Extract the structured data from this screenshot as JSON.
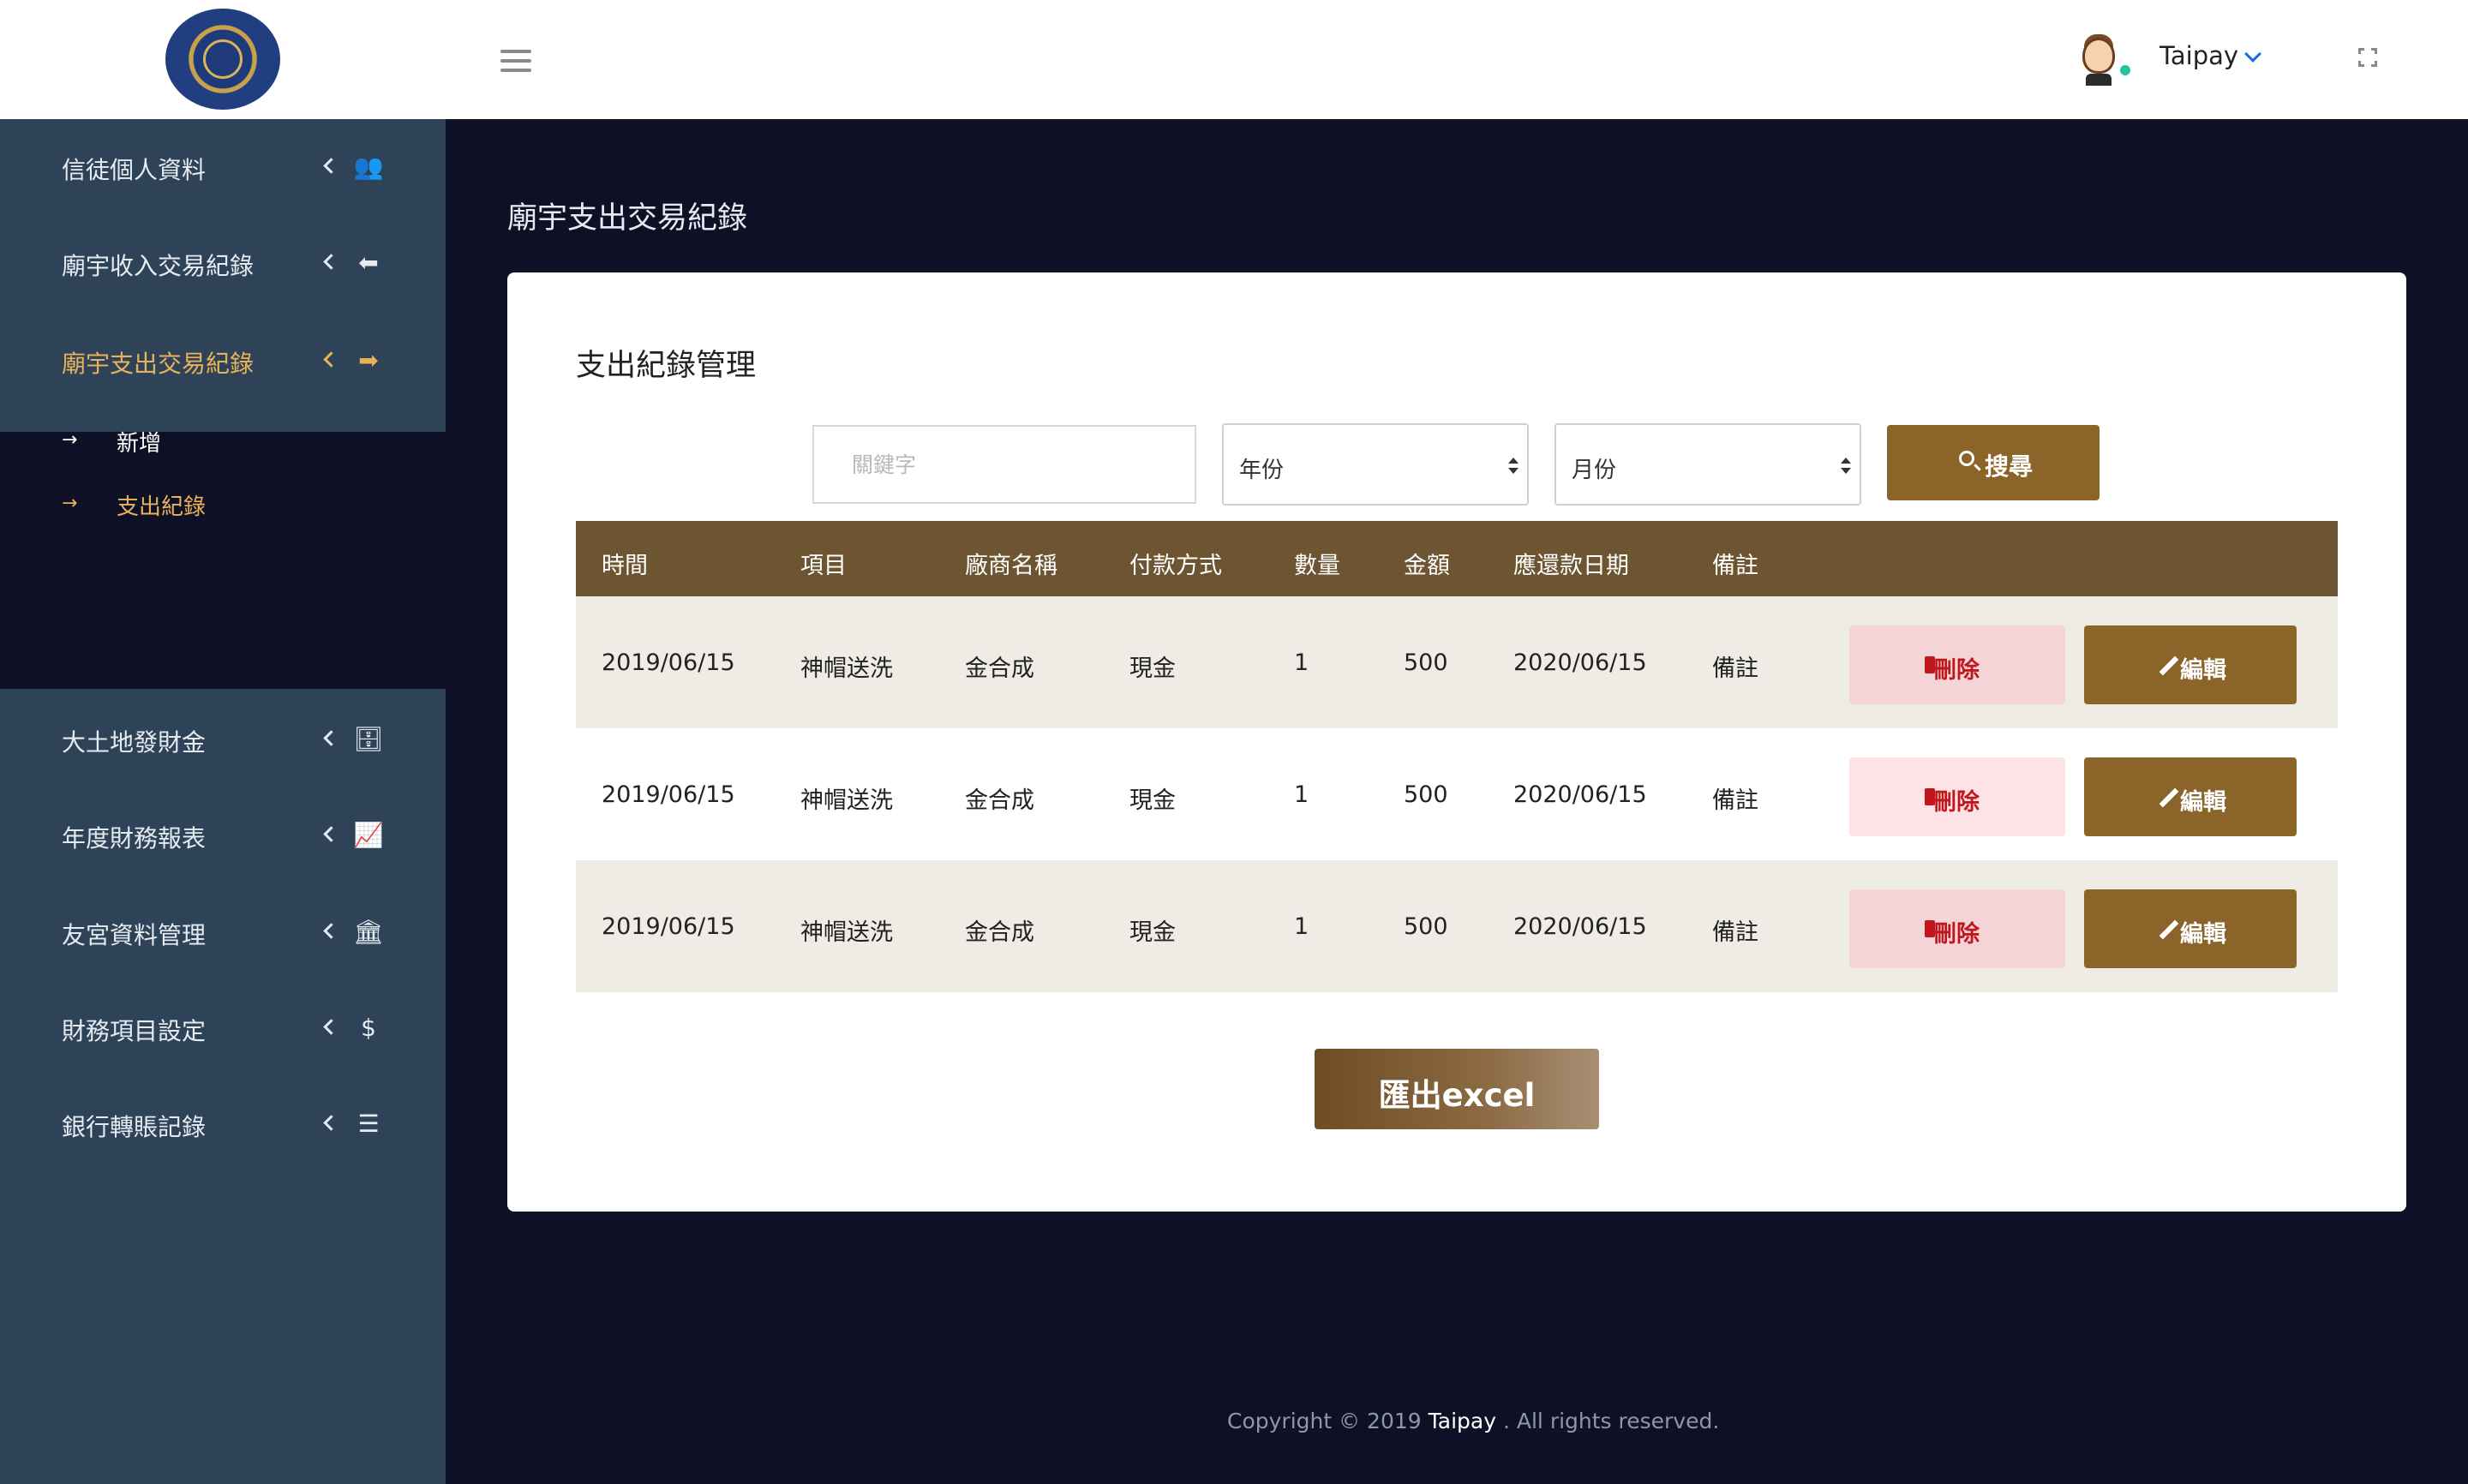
{
  "header": {
    "username": "Taipay",
    "icons": {
      "menu": "hamburger-icon",
      "user_dropdown": "chevron-down-icon",
      "fullscreen": "fullscreen-icon"
    },
    "status_color": "#22c5a0"
  },
  "sidebar": {
    "items": [
      {
        "label": "信徒個人資料",
        "icon": "users-icon",
        "glyph": "👥"
      },
      {
        "label": "廟宇收入交易紀錄",
        "icon": "arrow-left-icon",
        "glyph": "⬅"
      },
      {
        "label": "廟宇支出交易紀錄",
        "icon": "arrow-right-icon",
        "glyph": "➡",
        "active": true
      },
      {
        "label": "大土地發財金",
        "icon": "database-icon",
        "glyph": "🗄"
      },
      {
        "label": "年度財務報表",
        "icon": "chart-area-icon",
        "glyph": "📈"
      },
      {
        "label": "友宮資料管理",
        "icon": "bank-icon",
        "glyph": "🏛"
      },
      {
        "label": "財務項目設定",
        "icon": "dollar-icon",
        "glyph": "$"
      },
      {
        "label": "銀行轉賬記錄",
        "icon": "list-icon",
        "glyph": "☰"
      }
    ],
    "subitems": [
      {
        "label": "新增",
        "arrow": "→"
      },
      {
        "label": "支出紀錄",
        "arrow": "→",
        "active": true
      }
    ],
    "accent_color": "#e8b25a"
  },
  "main": {
    "page_title": "廟宇支出交易紀錄",
    "card_title": "支出紀錄管理",
    "search": {
      "keyword_placeholder": "關鍵字",
      "keyword_value": "",
      "year_selected": "年份",
      "month_selected": "月份",
      "button_label": "搜尋"
    },
    "table": {
      "headers": [
        "時間",
        "項目",
        "廠商名稱",
        "付款方式",
        "數量",
        "金額",
        "應還款日期",
        "備註"
      ],
      "rows": [
        [
          "2019/06/15",
          "神帽送洗",
          "金合成",
          "現金",
          "1",
          "500",
          "2020/06/15",
          "備註"
        ],
        [
          "2019/06/15",
          "神帽送洗",
          "金合成",
          "現金",
          "1",
          "500",
          "2020/06/15",
          "備註"
        ],
        [
          "2019/06/15",
          "神帽送洗",
          "金合成",
          "現金",
          "1",
          "500",
          "2020/06/15",
          "備註"
        ]
      ],
      "delete_label": "刪除",
      "edit_label": "編輯"
    },
    "export_label": "匯出excel",
    "brand_color": "#8b6429",
    "delete_bg_colors": [
      "#f5d4d7",
      "#fde3e6",
      "#f5d4d7"
    ]
  },
  "footer": {
    "prefix": "Copyright © 2019",
    "brand": "Taipay",
    "suffix": ". All rights reserved."
  }
}
